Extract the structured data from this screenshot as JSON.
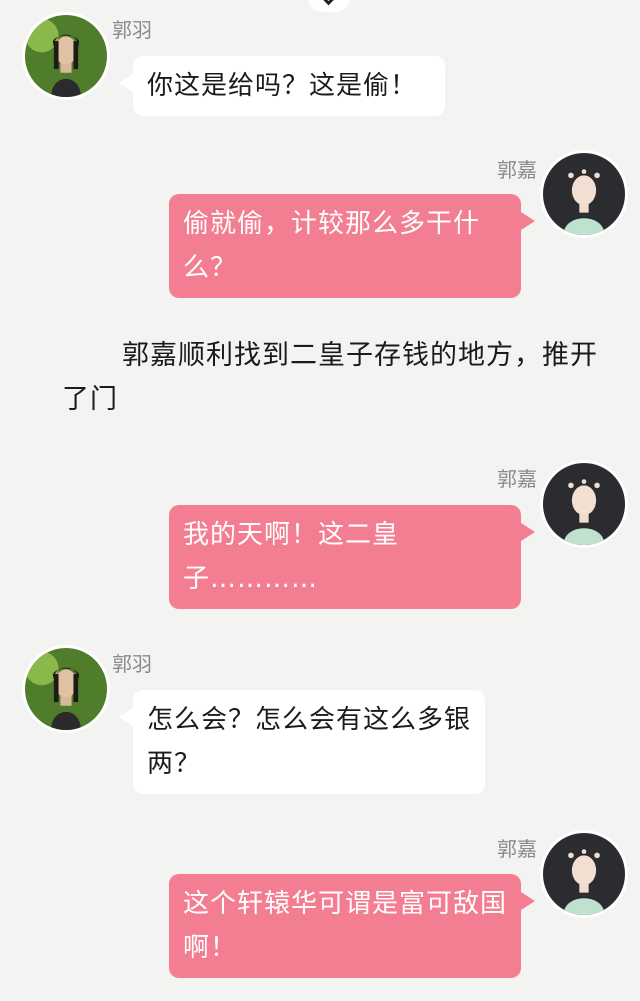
{
  "colors": {
    "background": "#f3f3f1",
    "left_bubble": "#ffffff",
    "right_bubble": "#f47e91",
    "name_text": "#8a8a8a"
  },
  "icons": {
    "top": "chevron-down-icon"
  },
  "messages": [
    {
      "speaker": "郭羽",
      "side": "left",
      "text": "你这是给吗？这是偷！"
    },
    {
      "speaker": "郭嘉",
      "side": "right",
      "text": "偷就偷，计较那么多干什么？"
    },
    {
      "speaker": "郭嘉",
      "side": "right",
      "text": "我的天啊！这二皇子…………"
    },
    {
      "speaker": "郭羽",
      "side": "left",
      "text": "怎么会？怎么会有这么多银两？"
    },
    {
      "speaker": "郭嘉",
      "side": "right",
      "text": "这个轩辕华可谓是富可敌国啊！"
    }
  ],
  "narration": "郭嘉顺利找到二皇子存钱的地方，推开了门"
}
